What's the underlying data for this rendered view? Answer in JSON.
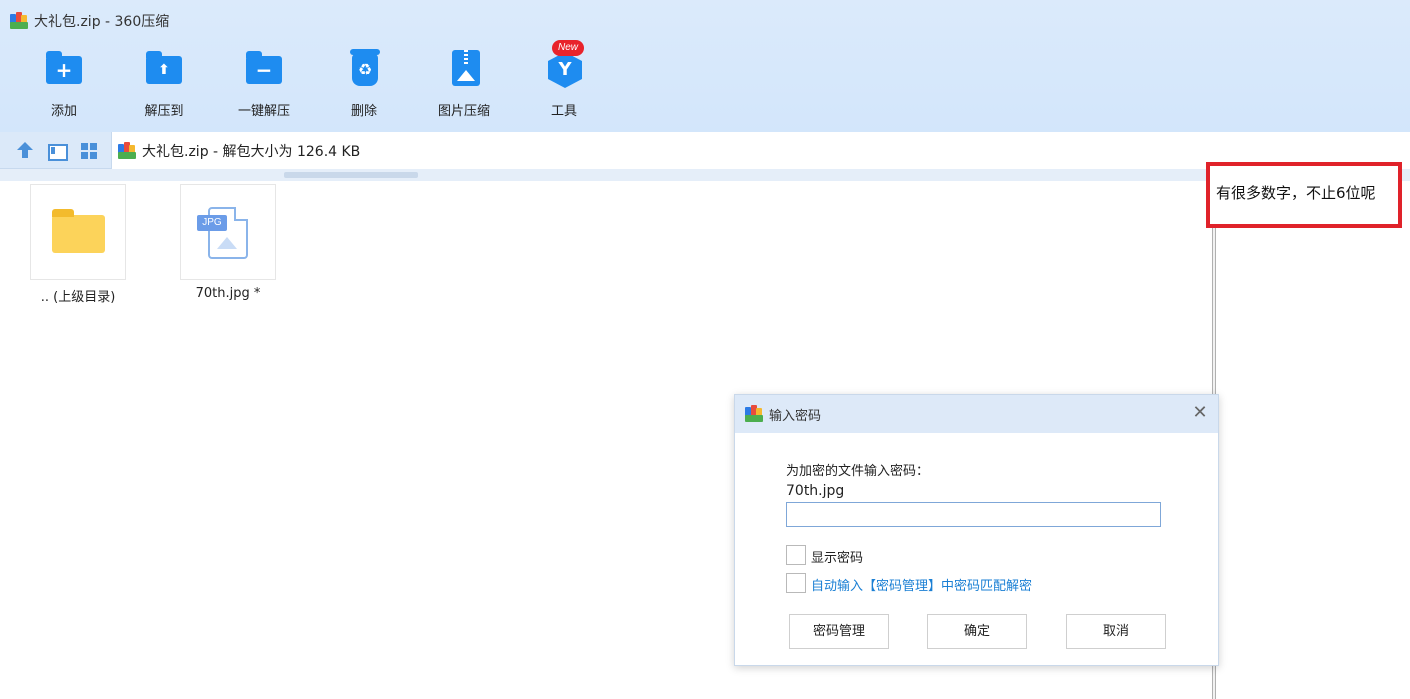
{
  "window": {
    "title": "大礼包.zip - 360压缩"
  },
  "toolbar": {
    "items": [
      {
        "label": "添加",
        "icon": "add-folder-icon",
        "symbol": "+"
      },
      {
        "label": "解压到",
        "icon": "extract-folder-icon",
        "symbol": "⬆"
      },
      {
        "label": "一键解压",
        "icon": "one-click-extract-icon",
        "symbol": "−"
      },
      {
        "label": "删除",
        "icon": "recycle-bin-icon",
        "symbol": "♻"
      },
      {
        "label": "图片压缩",
        "icon": "image-compress-icon",
        "symbol": ""
      },
      {
        "label": "工具",
        "icon": "tools-icon",
        "symbol": "Y"
      }
    ],
    "new_badge": "New"
  },
  "navbar": {
    "path": "大礼包.zip - 解包大小为 126.4 KB"
  },
  "files": [
    {
      "name": ".. (上级目录)",
      "type": "parent-folder"
    },
    {
      "name": "70th.jpg *",
      "type": "jpg",
      "tag": "JPG"
    }
  ],
  "annotation": {
    "text": "有很多数字，不止6位呢",
    "border_color": "#e0222a"
  },
  "dialog": {
    "title": "输入密码",
    "close_symbol": "✕",
    "prompt": "为加密的文件输入密码：",
    "filename": "70th.jpg",
    "password_value": "",
    "show_password_label": "显示密码",
    "auto_fill_label": "自动输入【密码管理】中密码匹配解密",
    "buttons": {
      "manage": "密码管理",
      "ok": "确定",
      "cancel": "取消"
    }
  },
  "colors": {
    "accent": "#1e8cf0",
    "link": "#1a7fd4",
    "header_bg": "#dbeafb"
  }
}
